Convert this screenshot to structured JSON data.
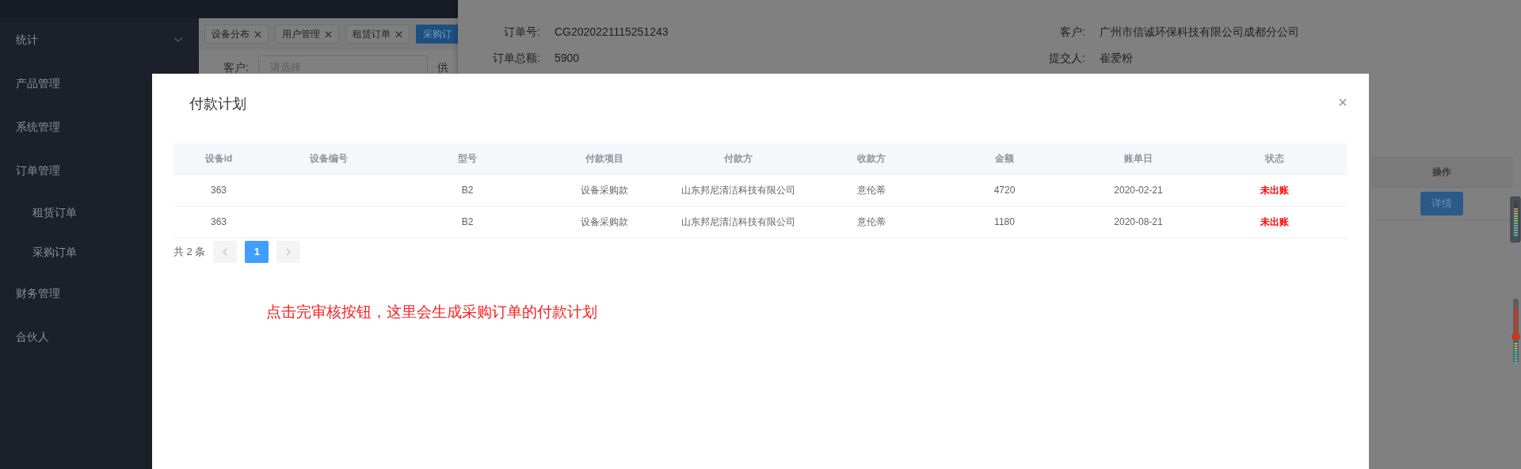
{
  "sidebar": {
    "items": [
      {
        "label": "统计",
        "collapsible": true
      },
      {
        "label": "产品管理",
        "collapsible": false
      },
      {
        "label": "系统管理",
        "collapsible": false
      },
      {
        "label": "订单管理",
        "collapsible": false,
        "children": [
          {
            "label": "租赁订单"
          },
          {
            "label": "采购订单"
          }
        ]
      },
      {
        "label": "财务管理",
        "collapsible": false
      },
      {
        "label": "合伙人",
        "collapsible": false
      }
    ]
  },
  "tabs": [
    {
      "label": "设备分布",
      "closable": true,
      "selected": false
    },
    {
      "label": "用户管理",
      "closable": true,
      "selected": false
    },
    {
      "label": "租赁订单",
      "closable": true,
      "selected": false
    },
    {
      "label": "采购订",
      "closable": false,
      "selected": true
    }
  ],
  "filter": {
    "label": "客户:",
    "placeholder": "请选择",
    "next_label": "供"
  },
  "drawer": {
    "fields": [
      {
        "label": "订单号:",
        "value": "CG2020221115251243"
      },
      {
        "label": "客户:",
        "value": "广州市信诚环保科技有限公司成都分公司"
      },
      {
        "label": "订单总额:",
        "value": "5900"
      },
      {
        "label": "提交人:",
        "value": "崔爱粉"
      }
    ],
    "table": {
      "columns": [
        "操作"
      ],
      "rows": [
        {
          "action": "详情"
        }
      ]
    }
  },
  "modal": {
    "title": "付款计划",
    "close": "×",
    "table": {
      "columns": [
        "设备id",
        "设备编号",
        "型号",
        "付款项目",
        "付款方",
        "收款方",
        "金额",
        "账单日",
        "状态"
      ],
      "rows": [
        {
          "cells": [
            "363",
            "",
            "B2",
            "设备采购款",
            "山东邦尼清洁科技有限公司",
            "意伦蒂",
            "4720",
            "2020-02-21",
            "未出账"
          ],
          "color": "#ff0000"
        },
        {
          "cells": [
            "363",
            "",
            "B2",
            "设备采购款",
            "山东邦尼清洁科技有限公司",
            "意伦蒂",
            "1180",
            "2020-08-21",
            "未出账"
          ],
          "color": "#ff0000"
        }
      ]
    },
    "pagination": {
      "total": "共 2 条",
      "pages": [
        {
          "label": "1",
          "selected": true
        }
      ]
    },
    "note": "点击完审核按钮，这里会生成采购订单的付款计划"
  }
}
